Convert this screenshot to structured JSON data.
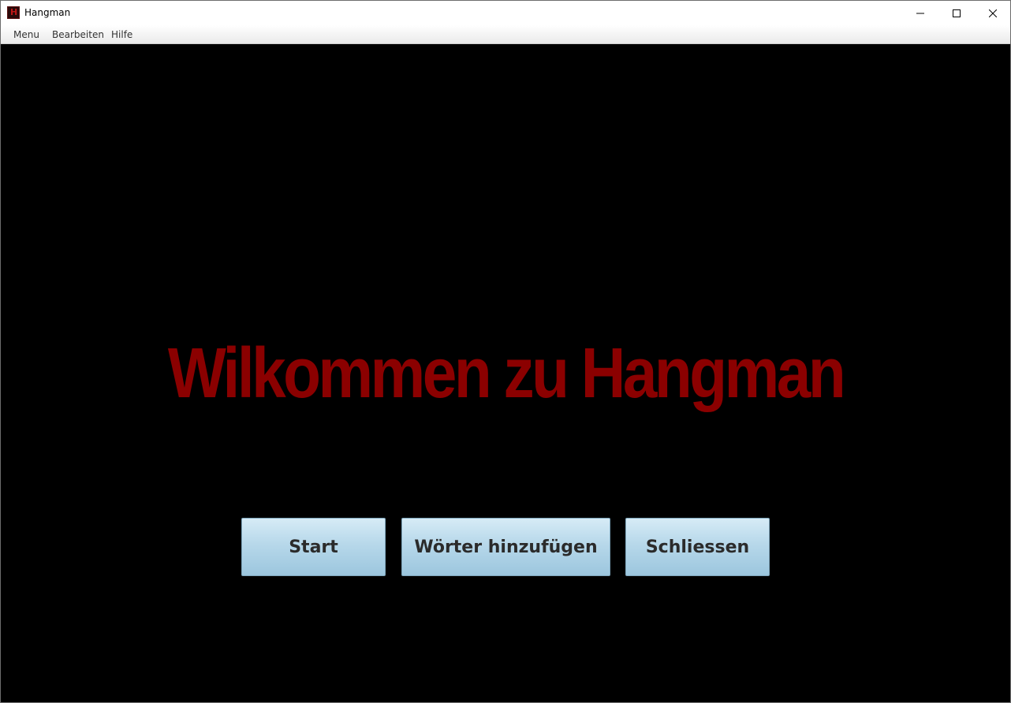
{
  "window": {
    "title": "Hangman",
    "icon": "hangman-app-icon",
    "icon_letter": "H",
    "controls": {
      "minimize_icon": "minimize-icon",
      "maximize_icon": "maximize-icon",
      "close_icon": "close-icon"
    }
  },
  "menubar": {
    "items": [
      {
        "label": "Menu"
      },
      {
        "label": "Bearbeiten"
      },
      {
        "label": "Hilfe"
      }
    ]
  },
  "main": {
    "headline": "Wilkommen zu Hangman",
    "buttons": [
      {
        "label": "Start"
      },
      {
        "label": "Wörter hinzufügen"
      },
      {
        "label": "Schliessen"
      }
    ]
  },
  "colors": {
    "background": "#000000",
    "headline": "#8b0000",
    "button_top": "#d6ebf6",
    "button_bottom": "#9cc6de",
    "button_text": "#2b2b2b"
  }
}
